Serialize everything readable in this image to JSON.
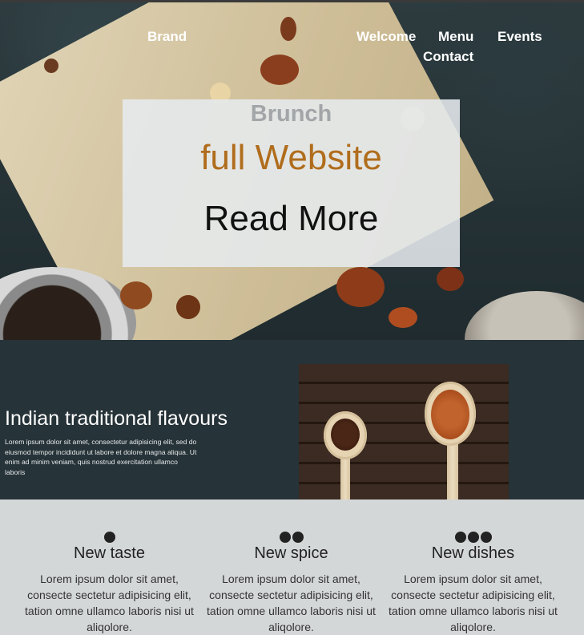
{
  "nav": {
    "brand": "Brand",
    "links": [
      "Welcome",
      "Menu",
      "Events",
      "Contact"
    ]
  },
  "hero": {
    "subtitle": "Brunch",
    "title": "full Website",
    "button": "Read More"
  },
  "feature": {
    "title": "Indian traditional flavours",
    "text": "Lorem ipsum dolor sit amet, consectetur adipisicing elit, sed do eiusmod tempor incididunt ut labore et dolore magna aliqua. Ut enim ad minim veniam, quis nostrud exercitation ullamco laboris"
  },
  "columns": [
    {
      "title": "New taste",
      "text": "Lorem ipsum dolor sit amet, consecte sectetur adipisicing elit, tation omne ullamco laboris nisi ut aliqolore."
    },
    {
      "title": "New spice",
      "text": "Lorem ipsum dolor sit amet, consecte sectetur adipisicing elit, tation omne ullamco laboris nisi ut aliqolore."
    },
    {
      "title": "New dishes",
      "text": "Lorem ipsum dolor sit amet, consecte sectetur adipisicing elit, tation omne ullamco laboris nisi ut aliqolore."
    }
  ],
  "colors": {
    "feature_bg": "#263338",
    "accent": "#b06d1c",
    "columns_bg": "#d4d7d8"
  }
}
